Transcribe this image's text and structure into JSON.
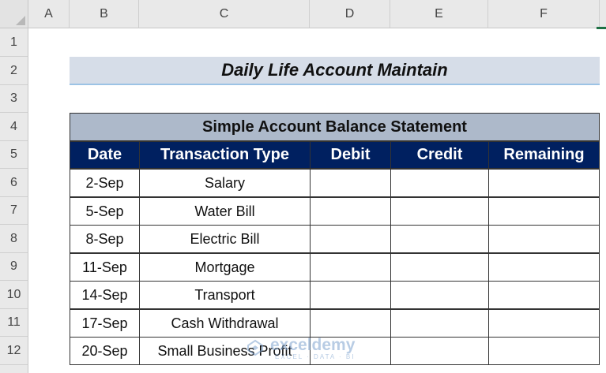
{
  "sheet": {
    "columns": [
      "A",
      "B",
      "C",
      "D",
      "E",
      "F"
    ],
    "rows": [
      "1",
      "2",
      "3",
      "4",
      "5",
      "6",
      "7",
      "8",
      "9",
      "10",
      "11",
      "12"
    ]
  },
  "title": "Daily Life Account Maintain",
  "statement": {
    "heading": "Simple Account Balance Statement",
    "headers": [
      "Date",
      "Transaction Type",
      "Debit",
      "Credit",
      "Remaining"
    ],
    "rows": [
      {
        "date": "2-Sep",
        "type": "Salary"
      },
      {
        "date": "5-Sep",
        "type": "Water Bill"
      },
      {
        "date": "8-Sep",
        "type": "Electric Bill"
      },
      {
        "date": "11-Sep",
        "type": "Mortgage"
      },
      {
        "date": "14-Sep",
        "type": "Transport"
      },
      {
        "date": "17-Sep",
        "type": "Cash Withdrawal"
      },
      {
        "date": "20-Sep",
        "type": "Small Business Profit"
      }
    ]
  },
  "watermark": {
    "name": "exceldemy",
    "tagline": "EXCEL · DATA · BI"
  },
  "colors": {
    "header_fill": "#002060",
    "statement_fill": "#adb9ca",
    "title_fill": "#d6dde8"
  }
}
